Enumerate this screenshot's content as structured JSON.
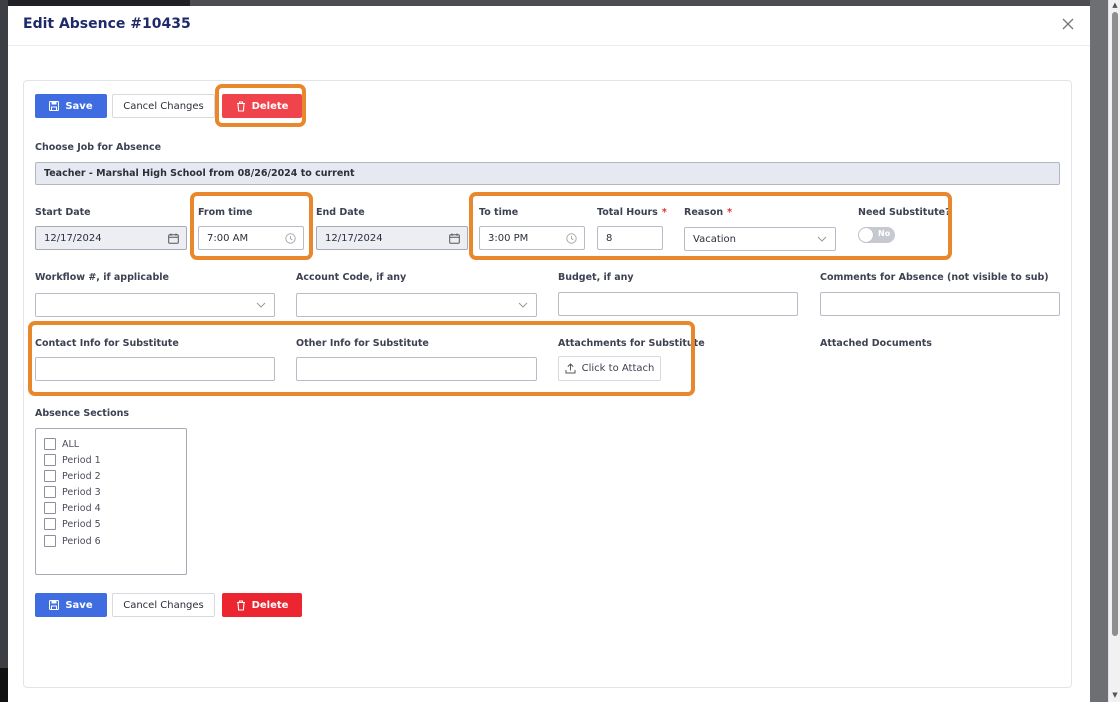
{
  "modal": {
    "title": "Edit Absence #10435"
  },
  "actions": {
    "save_label": "Save",
    "cancel_label": "Cancel Changes",
    "delete_label": "Delete"
  },
  "job": {
    "label": "Choose Job for Absence",
    "value": "Teacher - Marshal High School from 08/26/2024 to current"
  },
  "dates": {
    "start_date": {
      "label": "Start Date",
      "value": "12/17/2024"
    },
    "from_time": {
      "label": "From time",
      "value": "7:00 AM"
    },
    "end_date": {
      "label": "End Date",
      "value": "12/17/2024"
    },
    "to_time": {
      "label": "To time",
      "value": "3:00 PM"
    },
    "total_hours": {
      "label": "Total Hours",
      "value": "8",
      "required_mark": "*"
    },
    "reason": {
      "label": "Reason",
      "value": "Vacation",
      "required_mark": "*"
    },
    "need_substitute": {
      "label": "Need Substitute?",
      "value": "No"
    }
  },
  "extra_fields": {
    "workflow": {
      "label": "Workflow #, if applicable",
      "value": ""
    },
    "account_code": {
      "label": "Account Code, if any",
      "value": ""
    },
    "budget": {
      "label": "Budget, if any",
      "value": ""
    },
    "comments": {
      "label": "Comments for Absence (not visible to sub)",
      "value": ""
    }
  },
  "substitute": {
    "contact_info": {
      "label": "Contact Info for Substitute",
      "value": ""
    },
    "other_info": {
      "label": "Other Info for Substitute",
      "value": ""
    },
    "attachments": {
      "label": "Attachments for Substitute",
      "button_label": "Click to Attach"
    },
    "attached_documents": {
      "label": "Attached Documents"
    }
  },
  "sections": {
    "label": "Absence Sections",
    "items": [
      "ALL",
      "Period 1",
      "Period 2",
      "Period 3",
      "Period 4",
      "Period 5",
      "Period 6"
    ]
  },
  "colors": {
    "primary": "#3f6ce1",
    "danger": "#eb2630",
    "highlight": "#e8872b",
    "title": "#1f2a6b"
  }
}
